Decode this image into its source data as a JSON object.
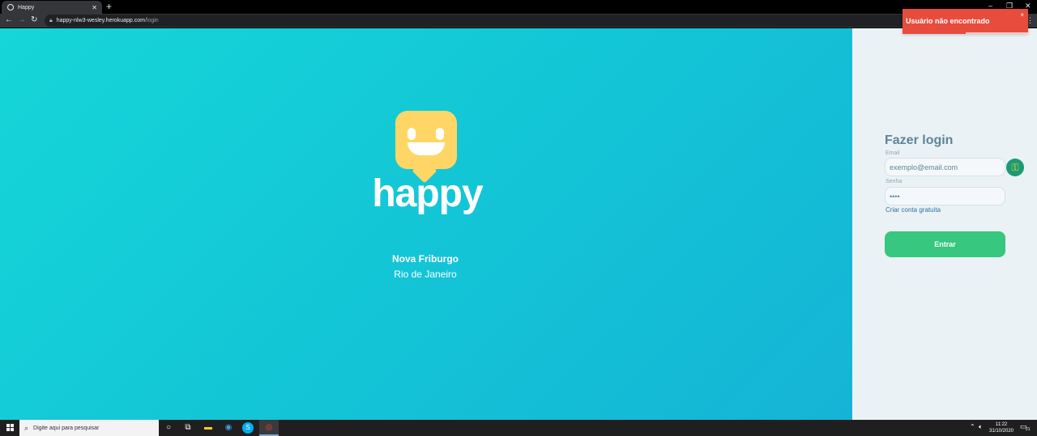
{
  "browser": {
    "tab_title": "Happy",
    "tab_close": "✕",
    "new_tab": "+",
    "url_host": "happy-nlw3-wesley.herokuapp.com",
    "url_path": "/login",
    "window_controls": [
      "–",
      "❐",
      "✕"
    ]
  },
  "hero": {
    "brand": "happy",
    "city": "Nova Friburgo",
    "state": "Rio de Janeiro"
  },
  "toast": {
    "message": "Usuário não encontrado",
    "close": "×"
  },
  "login": {
    "title": "Fazer login",
    "email_label": "Email",
    "email_value": "exemplo@email.com",
    "password_label": "Senha",
    "password_value": "••••",
    "signup_link": "Criar conta gratuita",
    "submit_label": "Entrar"
  },
  "taskbar": {
    "search_placeholder": "Digite aqui para pesquisar",
    "time": "11:22",
    "date": "31/10/2020",
    "notification_count": "21"
  },
  "colors": {
    "hero_gradient": [
      "#15d6d8",
      "#15b4d6"
    ],
    "panel_bg": "#ebf2f5",
    "toast_bg": "#e74c3c",
    "button_bg": "#37c77f",
    "logo_yellow": "#ffd666"
  }
}
